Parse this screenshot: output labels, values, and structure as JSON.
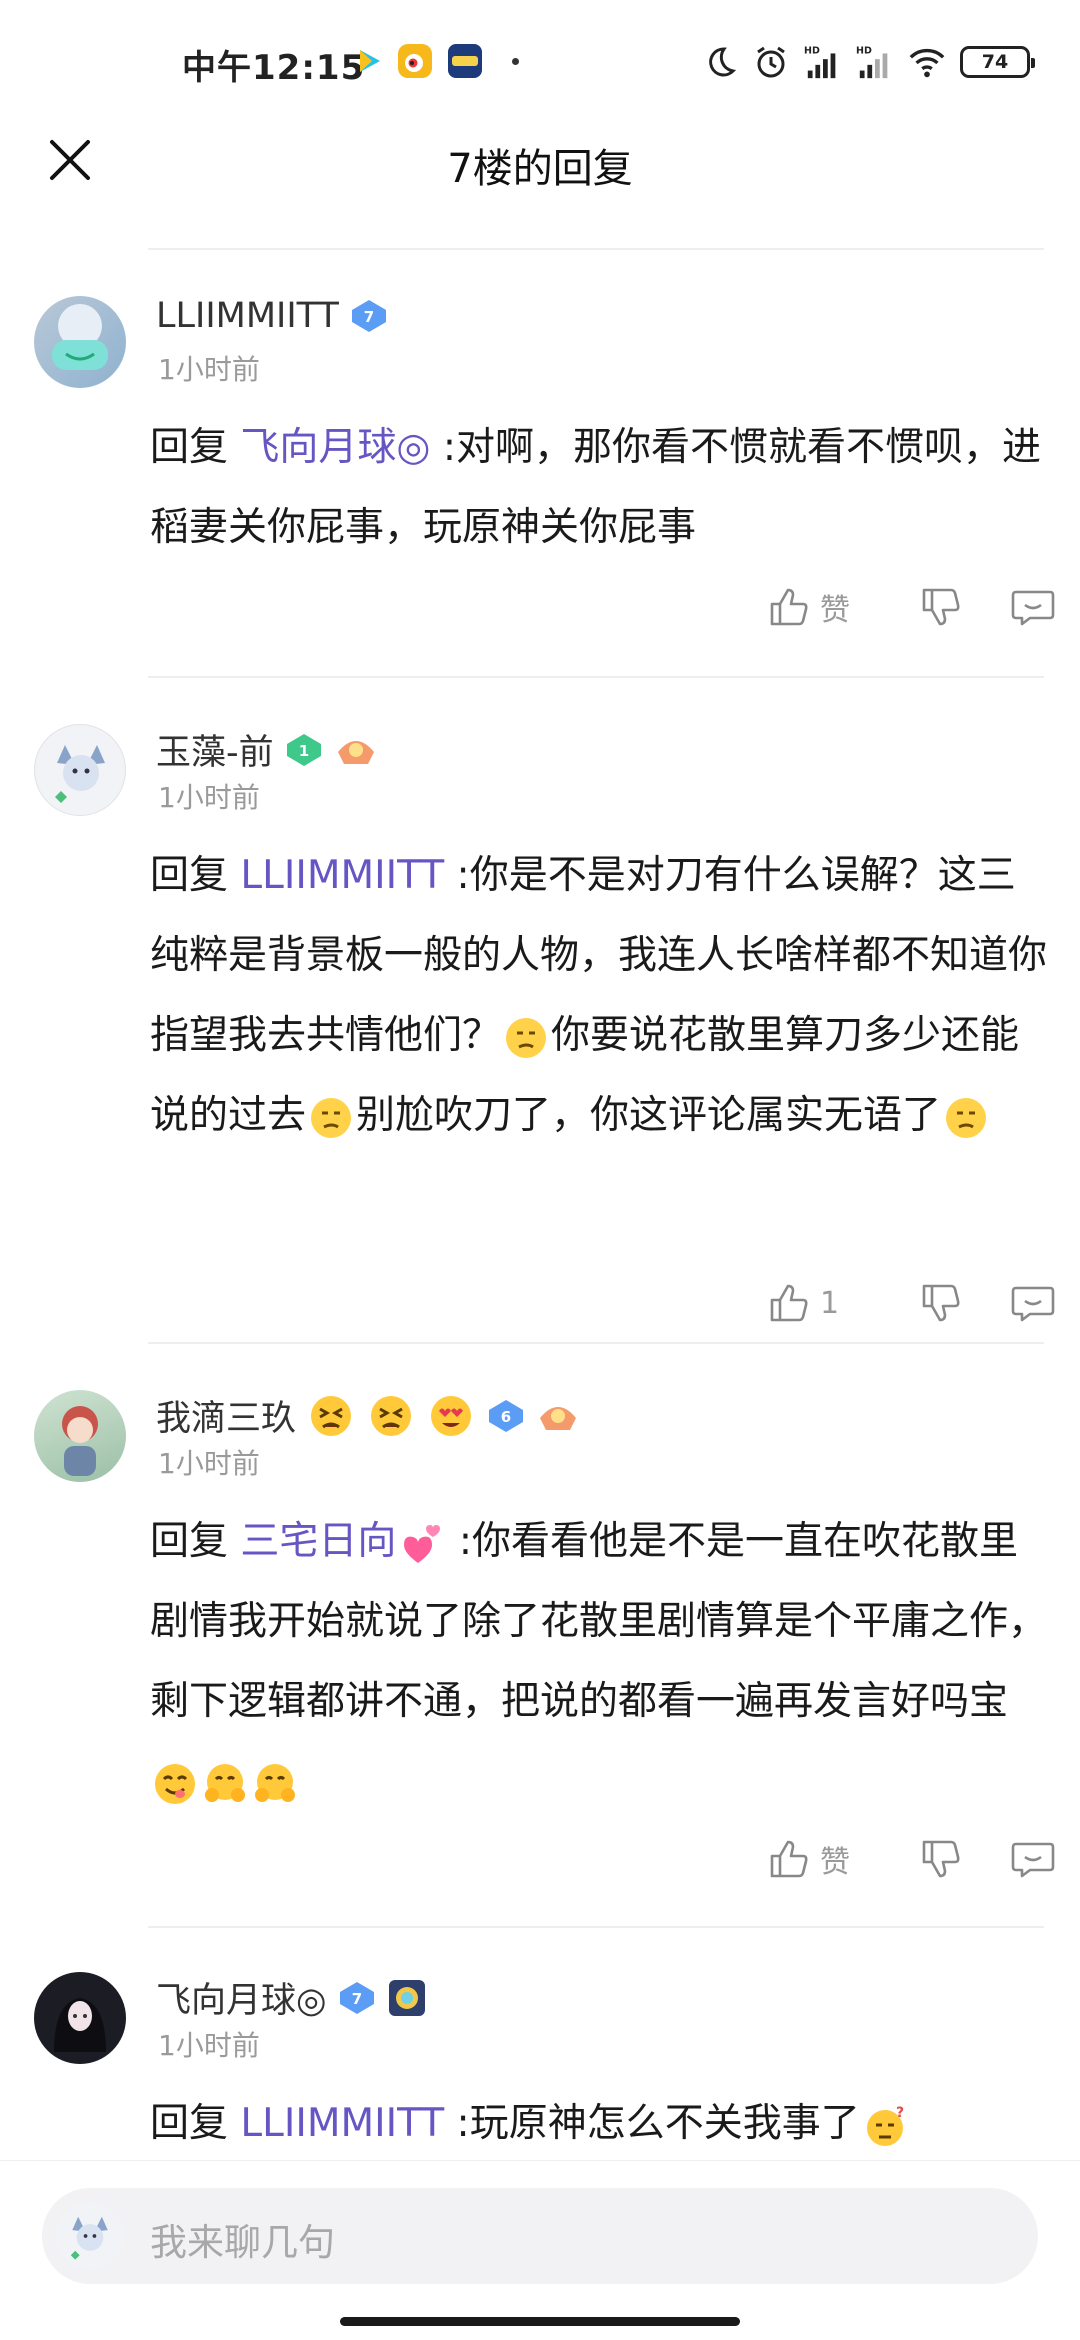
{
  "status_bar": {
    "time": "中午12:15",
    "battery": "74"
  },
  "header": {
    "title": "7楼的回复"
  },
  "comments": [
    {
      "user": "LLIIMMIITT",
      "level": "7",
      "time": "1小时前",
      "reply_word": "回复",
      "mention": "飞向月球◎",
      "text": " :对啊，那你看不惯就看不惯呗，进稻妻关你屁事，玩原神关你屁事",
      "like_label": "赞"
    },
    {
      "user": "玉藻-前",
      "level": "1",
      "time": "1小时前",
      "reply_word": "回复",
      "mention": "LLIIMMIITT",
      "text1": " :你是不是对刀有什么误解？这三纯粹是背景板一般的人物，我连人长啥样都不知道你指望我去共情他们？",
      "text2": "你要说花散里算刀多少还能说的过去",
      "text3": "别尬吹刀了，你这评论属实无语了",
      "like_label": "1"
    },
    {
      "user": "我滴三玖",
      "level": "6",
      "time": "1小时前",
      "reply_word": "回复",
      "mention": "三宅日向",
      "text": " :你看看他是不是一直在吹花散里剧情我开始就说了除了花散里剧情算是个平庸之作，剩下逻辑都讲不通，把说的都看一遍再发言好吗宝",
      "like_label": "赞"
    },
    {
      "user": "飞向月球◎",
      "level": "7",
      "time": "1小时前",
      "reply_word": "回复",
      "mention": "LLIIMMIITT",
      "text": " :玩原神怎么不关我事了"
    }
  ],
  "input": {
    "placeholder": "我来聊几句"
  },
  "colors": {
    "mention": "#6656c4",
    "muted": "#9a9a9a",
    "badge_blue": "#5b9cf5",
    "badge_green": "#3ec98a"
  },
  "icons": [
    "close-icon",
    "thumbs-up-icon",
    "thumbs-down-icon",
    "reply-bubble-icon",
    "level-badge-icon",
    "moon-icon",
    "alarm-icon",
    "signal-icon",
    "wifi-icon",
    "battery-icon"
  ]
}
